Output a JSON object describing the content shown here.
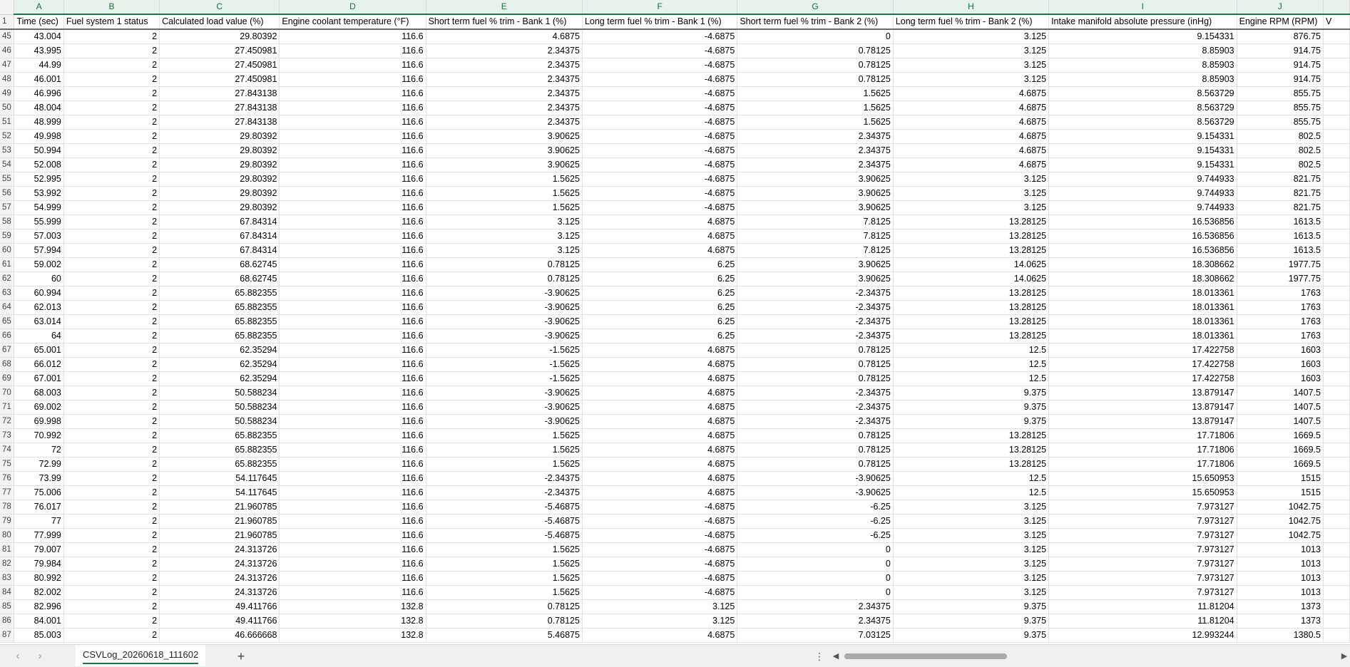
{
  "columns": [
    "",
    "A",
    "B",
    "C",
    "D",
    "E",
    "F",
    "G",
    "H",
    "I",
    "J",
    ""
  ],
  "header_row": {
    "row_number": "1",
    "cells": [
      "Time (sec)",
      "Fuel system 1 status",
      "Calculated load value (%)",
      "Engine coolant temperature (°F)",
      "Short term fuel % trim - Bank 1 (%)",
      "Long term fuel % trim - Bank 1 (%)",
      "Short term fuel % trim - Bank 2 (%)",
      "Long term fuel % trim - Bank 2 (%)",
      "Intake manifold absolute pressure (inHg)",
      "Engine RPM (RPM)",
      "V"
    ]
  },
  "rows": [
    {
      "n": "45",
      "c": [
        "43.004",
        "2",
        "29.80392",
        "116.6",
        "4.6875",
        "-4.6875",
        "0",
        "3.125",
        "9.154331",
        "876.75",
        ""
      ]
    },
    {
      "n": "46",
      "c": [
        "43.995",
        "2",
        "27.450981",
        "116.6",
        "2.34375",
        "-4.6875",
        "0.78125",
        "3.125",
        "8.85903",
        "914.75",
        ""
      ]
    },
    {
      "n": "47",
      "c": [
        "44.99",
        "2",
        "27.450981",
        "116.6",
        "2.34375",
        "-4.6875",
        "0.78125",
        "3.125",
        "8.85903",
        "914.75",
        ""
      ]
    },
    {
      "n": "48",
      "c": [
        "46.001",
        "2",
        "27.450981",
        "116.6",
        "2.34375",
        "-4.6875",
        "0.78125",
        "3.125",
        "8.85903",
        "914.75",
        ""
      ]
    },
    {
      "n": "49",
      "c": [
        "46.996",
        "2",
        "27.843138",
        "116.6",
        "2.34375",
        "-4.6875",
        "1.5625",
        "4.6875",
        "8.563729",
        "855.75",
        ""
      ]
    },
    {
      "n": "50",
      "c": [
        "48.004",
        "2",
        "27.843138",
        "116.6",
        "2.34375",
        "-4.6875",
        "1.5625",
        "4.6875",
        "8.563729",
        "855.75",
        ""
      ]
    },
    {
      "n": "51",
      "c": [
        "48.999",
        "2",
        "27.843138",
        "116.6",
        "2.34375",
        "-4.6875",
        "1.5625",
        "4.6875",
        "8.563729",
        "855.75",
        ""
      ]
    },
    {
      "n": "52",
      "c": [
        "49.998",
        "2",
        "29.80392",
        "116.6",
        "3.90625",
        "-4.6875",
        "2.34375",
        "4.6875",
        "9.154331",
        "802.5",
        ""
      ]
    },
    {
      "n": "53",
      "c": [
        "50.994",
        "2",
        "29.80392",
        "116.6",
        "3.90625",
        "-4.6875",
        "2.34375",
        "4.6875",
        "9.154331",
        "802.5",
        ""
      ]
    },
    {
      "n": "54",
      "c": [
        "52.008",
        "2",
        "29.80392",
        "116.6",
        "3.90625",
        "-4.6875",
        "2.34375",
        "4.6875",
        "9.154331",
        "802.5",
        ""
      ]
    },
    {
      "n": "55",
      "c": [
        "52.995",
        "2",
        "29.80392",
        "116.6",
        "1.5625",
        "-4.6875",
        "3.90625",
        "3.125",
        "9.744933",
        "821.75",
        ""
      ]
    },
    {
      "n": "56",
      "c": [
        "53.992",
        "2",
        "29.80392",
        "116.6",
        "1.5625",
        "-4.6875",
        "3.90625",
        "3.125",
        "9.744933",
        "821.75",
        ""
      ]
    },
    {
      "n": "57",
      "c": [
        "54.999",
        "2",
        "29.80392",
        "116.6",
        "1.5625",
        "-4.6875",
        "3.90625",
        "3.125",
        "9.744933",
        "821.75",
        ""
      ]
    },
    {
      "n": "58",
      "c": [
        "55.999",
        "2",
        "67.84314",
        "116.6",
        "3.125",
        "4.6875",
        "7.8125",
        "13.28125",
        "16.536856",
        "1613.5",
        ""
      ]
    },
    {
      "n": "59",
      "c": [
        "57.003",
        "2",
        "67.84314",
        "116.6",
        "3.125",
        "4.6875",
        "7.8125",
        "13.28125",
        "16.536856",
        "1613.5",
        ""
      ]
    },
    {
      "n": "60",
      "c": [
        "57.994",
        "2",
        "67.84314",
        "116.6",
        "3.125",
        "4.6875",
        "7.8125",
        "13.28125",
        "16.536856",
        "1613.5",
        ""
      ]
    },
    {
      "n": "61",
      "c": [
        "59.002",
        "2",
        "68.62745",
        "116.6",
        "0.78125",
        "6.25",
        "3.90625",
        "14.0625",
        "18.308662",
        "1977.75",
        ""
      ]
    },
    {
      "n": "62",
      "c": [
        "60",
        "2",
        "68.62745",
        "116.6",
        "0.78125",
        "6.25",
        "3.90625",
        "14.0625",
        "18.308662",
        "1977.75",
        ""
      ]
    },
    {
      "n": "63",
      "c": [
        "60.994",
        "2",
        "65.882355",
        "116.6",
        "-3.90625",
        "6.25",
        "-2.34375",
        "13.28125",
        "18.013361",
        "1763",
        ""
      ]
    },
    {
      "n": "64",
      "c": [
        "62.013",
        "2",
        "65.882355",
        "116.6",
        "-3.90625",
        "6.25",
        "-2.34375",
        "13.28125",
        "18.013361",
        "1763",
        ""
      ]
    },
    {
      "n": "65",
      "c": [
        "63.014",
        "2",
        "65.882355",
        "116.6",
        "-3.90625",
        "6.25",
        "-2.34375",
        "13.28125",
        "18.013361",
        "1763",
        ""
      ]
    },
    {
      "n": "66",
      "c": [
        "64",
        "2",
        "65.882355",
        "116.6",
        "-3.90625",
        "6.25",
        "-2.34375",
        "13.28125",
        "18.013361",
        "1763",
        ""
      ]
    },
    {
      "n": "67",
      "c": [
        "65.001",
        "2",
        "62.35294",
        "116.6",
        "-1.5625",
        "4.6875",
        "0.78125",
        "12.5",
        "17.422758",
        "1603",
        ""
      ]
    },
    {
      "n": "68",
      "c": [
        "66.012",
        "2",
        "62.35294",
        "116.6",
        "-1.5625",
        "4.6875",
        "0.78125",
        "12.5",
        "17.422758",
        "1603",
        ""
      ]
    },
    {
      "n": "69",
      "c": [
        "67.001",
        "2",
        "62.35294",
        "116.6",
        "-1.5625",
        "4.6875",
        "0.78125",
        "12.5",
        "17.422758",
        "1603",
        ""
      ]
    },
    {
      "n": "70",
      "c": [
        "68.003",
        "2",
        "50.588234",
        "116.6",
        "-3.90625",
        "4.6875",
        "-2.34375",
        "9.375",
        "13.879147",
        "1407.5",
        ""
      ]
    },
    {
      "n": "71",
      "c": [
        "69.002",
        "2",
        "50.588234",
        "116.6",
        "-3.90625",
        "4.6875",
        "-2.34375",
        "9.375",
        "13.879147",
        "1407.5",
        ""
      ]
    },
    {
      "n": "72",
      "c": [
        "69.998",
        "2",
        "50.588234",
        "116.6",
        "-3.90625",
        "4.6875",
        "-2.34375",
        "9.375",
        "13.879147",
        "1407.5",
        ""
      ]
    },
    {
      "n": "73",
      "c": [
        "70.992",
        "2",
        "65.882355",
        "116.6",
        "1.5625",
        "4.6875",
        "0.78125",
        "13.28125",
        "17.71806",
        "1669.5",
        ""
      ]
    },
    {
      "n": "74",
      "c": [
        "72",
        "2",
        "65.882355",
        "116.6",
        "1.5625",
        "4.6875",
        "0.78125",
        "13.28125",
        "17.71806",
        "1669.5",
        ""
      ]
    },
    {
      "n": "75",
      "c": [
        "72.99",
        "2",
        "65.882355",
        "116.6",
        "1.5625",
        "4.6875",
        "0.78125",
        "13.28125",
        "17.71806",
        "1669.5",
        ""
      ]
    },
    {
      "n": "76",
      "c": [
        "73.99",
        "2",
        "54.117645",
        "116.6",
        "-2.34375",
        "4.6875",
        "-3.90625",
        "12.5",
        "15.650953",
        "1515",
        ""
      ]
    },
    {
      "n": "77",
      "c": [
        "75.006",
        "2",
        "54.117645",
        "116.6",
        "-2.34375",
        "4.6875",
        "-3.90625",
        "12.5",
        "15.650953",
        "1515",
        ""
      ]
    },
    {
      "n": "78",
      "c": [
        "76.017",
        "2",
        "21.960785",
        "116.6",
        "-5.46875",
        "-4.6875",
        "-6.25",
        "3.125",
        "7.973127",
        "1042.75",
        ""
      ]
    },
    {
      "n": "79",
      "c": [
        "77",
        "2",
        "21.960785",
        "116.6",
        "-5.46875",
        "-4.6875",
        "-6.25",
        "3.125",
        "7.973127",
        "1042.75",
        ""
      ]
    },
    {
      "n": "80",
      "c": [
        "77.999",
        "2",
        "21.960785",
        "116.6",
        "-5.46875",
        "-4.6875",
        "-6.25",
        "3.125",
        "7.973127",
        "1042.75",
        ""
      ]
    },
    {
      "n": "81",
      "c": [
        "79.007",
        "2",
        "24.313726",
        "116.6",
        "1.5625",
        "-4.6875",
        "0",
        "3.125",
        "7.973127",
        "1013",
        ""
      ]
    },
    {
      "n": "82",
      "c": [
        "79.984",
        "2",
        "24.313726",
        "116.6",
        "1.5625",
        "-4.6875",
        "0",
        "3.125",
        "7.973127",
        "1013",
        ""
      ]
    },
    {
      "n": "83",
      "c": [
        "80.992",
        "2",
        "24.313726",
        "116.6",
        "1.5625",
        "-4.6875",
        "0",
        "3.125",
        "7.973127",
        "1013",
        ""
      ]
    },
    {
      "n": "84",
      "c": [
        "82.002",
        "2",
        "24.313726",
        "116.6",
        "1.5625",
        "-4.6875",
        "0",
        "3.125",
        "7.973127",
        "1013",
        ""
      ]
    },
    {
      "n": "85",
      "c": [
        "82.996",
        "2",
        "49.411766",
        "132.8",
        "0.78125",
        "3.125",
        "2.34375",
        "9.375",
        "11.81204",
        "1373",
        ""
      ]
    },
    {
      "n": "86",
      "c": [
        "84.001",
        "2",
        "49.411766",
        "132.8",
        "0.78125",
        "3.125",
        "2.34375",
        "9.375",
        "11.81204",
        "1373",
        ""
      ]
    },
    {
      "n": "87",
      "c": [
        "85.003",
        "2",
        "46.666668",
        "132.8",
        "5.46875",
        "4.6875",
        "7.03125",
        "9.375",
        "12.993244",
        "1380.5",
        ""
      ]
    }
  ],
  "sheet_tab": {
    "name": "CSVLog_20260618_111602",
    "accent_color": "#217346"
  },
  "nav": {
    "prev_icon": "‹",
    "next_icon": "›",
    "add_icon": "+",
    "more_icon": "⋮",
    "scroll_left_icon": "◀",
    "scroll_right_icon": "▶"
  },
  "colors": {
    "header_bg": "#f3f3f3",
    "accent": "#217346",
    "gridline": "#e1e1e1"
  }
}
